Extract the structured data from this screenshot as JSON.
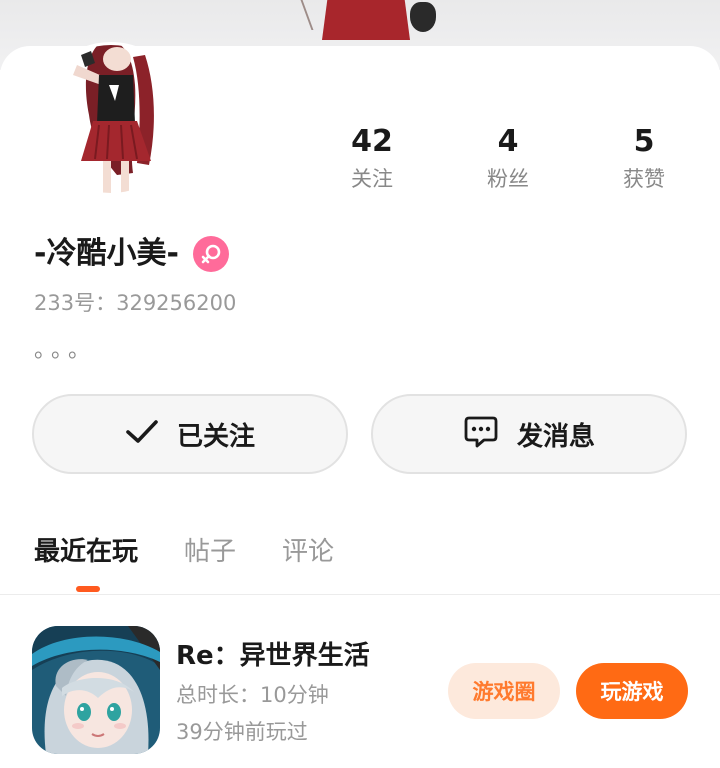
{
  "profile": {
    "nickname": "-冷酷小美-",
    "id_label": "233号：",
    "id_value": "329256200",
    "bio": "。。。"
  },
  "stats": [
    {
      "value": "42",
      "label": "关注"
    },
    {
      "value": "4",
      "label": "粉丝"
    },
    {
      "value": "5",
      "label": "获赞"
    }
  ],
  "actions": {
    "follow_label": "已关注",
    "message_label": "发消息"
  },
  "tabs": [
    {
      "label": "最近在玩",
      "active": true
    },
    {
      "label": "帖子",
      "active": false
    },
    {
      "label": "评论",
      "active": false
    }
  ],
  "games": [
    {
      "title": "Re：异世界生活",
      "playtime": "总时长：10分钟",
      "last_played": "39分钟前玩过",
      "circle_label": "游戏圈",
      "play_label": "玩游戏"
    }
  ],
  "colors": {
    "accent": "#ff6a14",
    "gender_female": "#ff6b9a",
    "tab_indicator": "#ff5a1f"
  },
  "icons": {
    "gender": "female-icon",
    "follow": "check-icon",
    "message": "chat-bubble-icon"
  }
}
